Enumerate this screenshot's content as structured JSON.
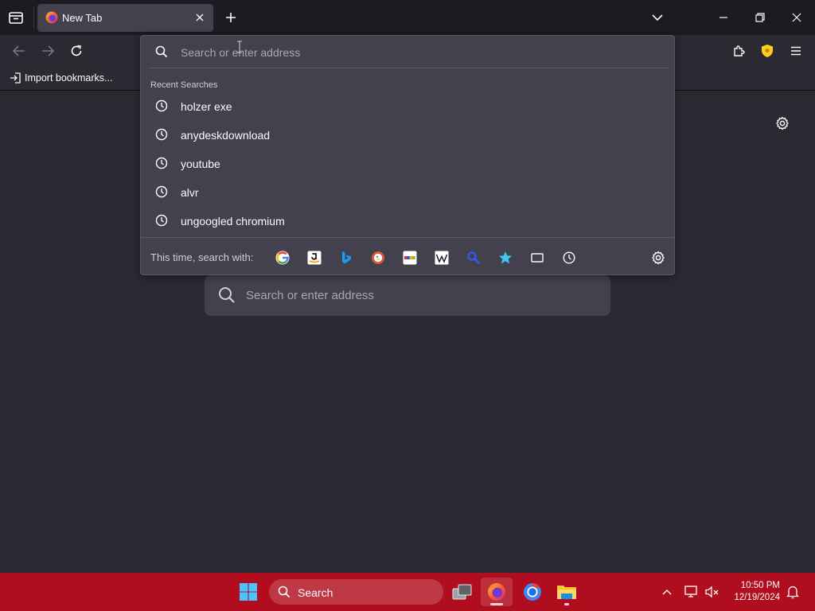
{
  "browser": {
    "tab": {
      "title": "New Tab"
    },
    "bookmarks_toolbar": {
      "import_label": "Import bookmarks..."
    },
    "urlbar": {
      "placeholder": "Search or enter address",
      "recent_heading": "Recent Searches",
      "recent_searches": [
        "holzer exe",
        "anydeskdownload",
        "youtube",
        "alvr",
        "ungoogled chromium"
      ],
      "search_with_label": "This time, search with:",
      "engines": [
        "google",
        "amazon",
        "bing",
        "duckduckgo",
        "ebay",
        "wikipedia",
        "search",
        "bookmarks",
        "tabs",
        "history"
      ]
    },
    "newtab": {
      "search_placeholder": "Search or enter address"
    }
  },
  "taskbar": {
    "search_label": "Search",
    "clock": {
      "time": "10:50 PM",
      "date": "12/19/2024"
    }
  },
  "colors": {
    "toolbar_bg": "#2b2a33",
    "tabstrip_bg": "#1c1b22",
    "panel_bg": "#42414d",
    "taskbar_bg": "#b00d1e",
    "shield_yellow": "#ffcc1a"
  }
}
